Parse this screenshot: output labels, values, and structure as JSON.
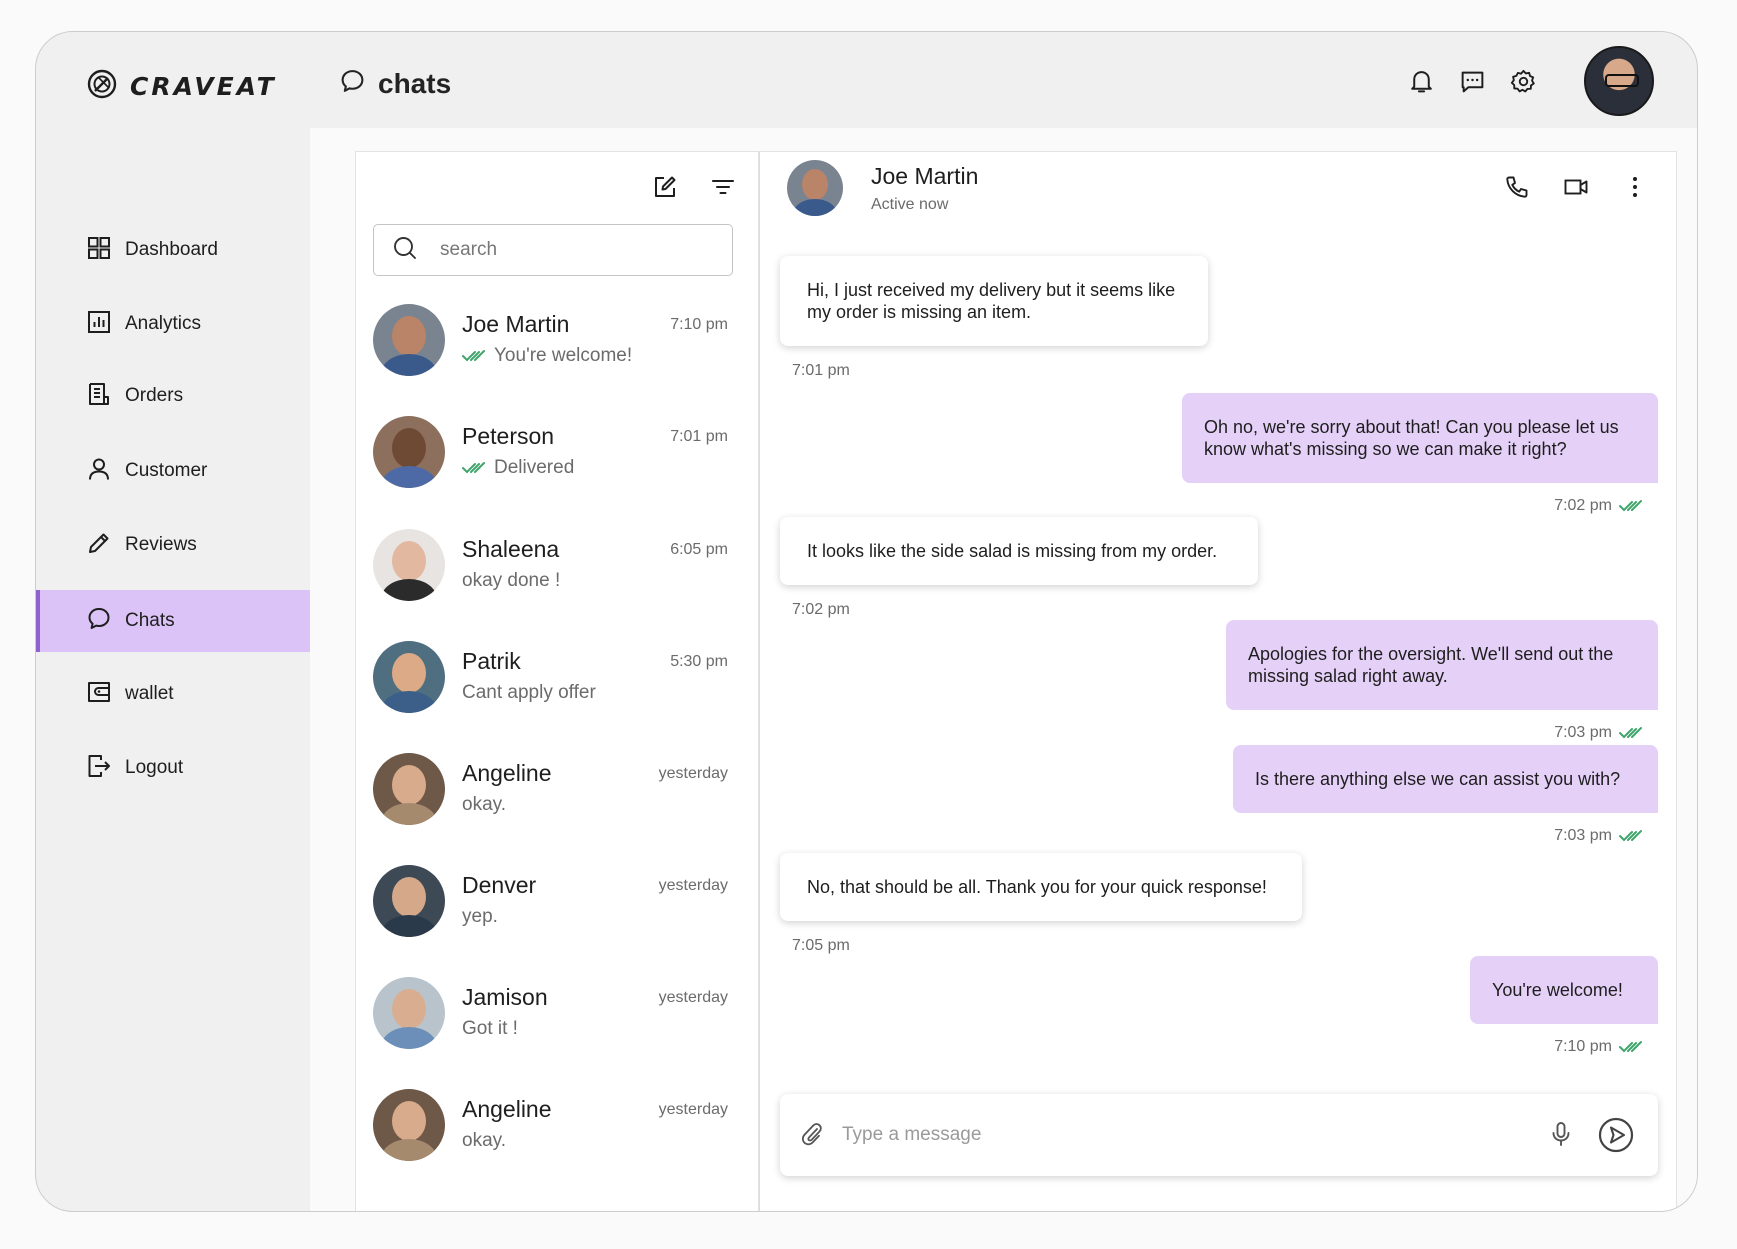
{
  "app": {
    "brand": "CRAVEAT",
    "page_title": "chats"
  },
  "top_icons": [
    "bell-icon",
    "message-icon",
    "gear-icon"
  ],
  "sidebar": {
    "items": [
      {
        "label": "Dashboard",
        "icon": "grid-icon"
      },
      {
        "label": "Analytics",
        "icon": "analytics-icon"
      },
      {
        "label": "Orders",
        "icon": "orders-icon"
      },
      {
        "label": "Customer",
        "icon": "user-icon"
      },
      {
        "label": "Reviews",
        "icon": "pencil-icon"
      },
      {
        "label": "Chats",
        "icon": "chat-icon",
        "active": true
      },
      {
        "label": "wallet",
        "icon": "wallet-icon"
      },
      {
        "label": "Logout",
        "icon": "logout-icon"
      }
    ]
  },
  "search": {
    "placeholder": "search"
  },
  "contacts": [
    {
      "name": "Joe Martin",
      "time": "7:10 pm",
      "message": "You're welcome!",
      "read": true
    },
    {
      "name": "Peterson",
      "time": "7:01 pm",
      "message": "Delivered",
      "read": true
    },
    {
      "name": "Shaleena",
      "time": "6:05 pm",
      "message": "okay done !"
    },
    {
      "name": "Patrik",
      "time": "5:30 pm",
      "message": "Cant apply offer"
    },
    {
      "name": "Angeline",
      "time": "yesterday",
      "message": "okay."
    },
    {
      "name": "Denver",
      "time": "yesterday",
      "message": "yep."
    },
    {
      "name": "Jamison",
      "time": "yesterday",
      "message": "Got it  !"
    },
    {
      "name": "Angeline",
      "time": "yesterday",
      "message": "okay."
    }
  ],
  "conversation": {
    "name": "Joe Martin",
    "status": "Active now",
    "messages": [
      {
        "direction": "in",
        "text": "Hi, I just received my delivery but it seems like my order is missing an item.",
        "time": "7:01 pm"
      },
      {
        "direction": "out",
        "text": "Oh no, we're sorry about that! Can you please let us know what's missing so we can make it right?",
        "time": "7:02 pm",
        "read": true
      },
      {
        "direction": "in",
        "text": "It looks like the side salad is missing from my order.",
        "time": "7:02 pm"
      },
      {
        "direction": "out",
        "text": "Apologies for the oversight. We'll send out the missing salad right away.",
        "time": "7:03 pm",
        "read": true
      },
      {
        "direction": "out",
        "text": "Is there anything else we can assist you with?",
        "time": "7:03 pm",
        "read": true
      },
      {
        "direction": "in",
        "text": "No, that should be all. Thank you for your quick response!",
        "time": "7:05 pm"
      },
      {
        "direction": "out",
        "text": "You're welcome!",
        "time": "7:10 pm",
        "read": true
      }
    ]
  },
  "composer": {
    "placeholder": "Type a message"
  },
  "colors": {
    "accent": "#dcc3f7",
    "accent_border": "#8f63cf",
    "outgoing_bubble": "#e5d0f8",
    "read_tick": "#3fa56b"
  }
}
